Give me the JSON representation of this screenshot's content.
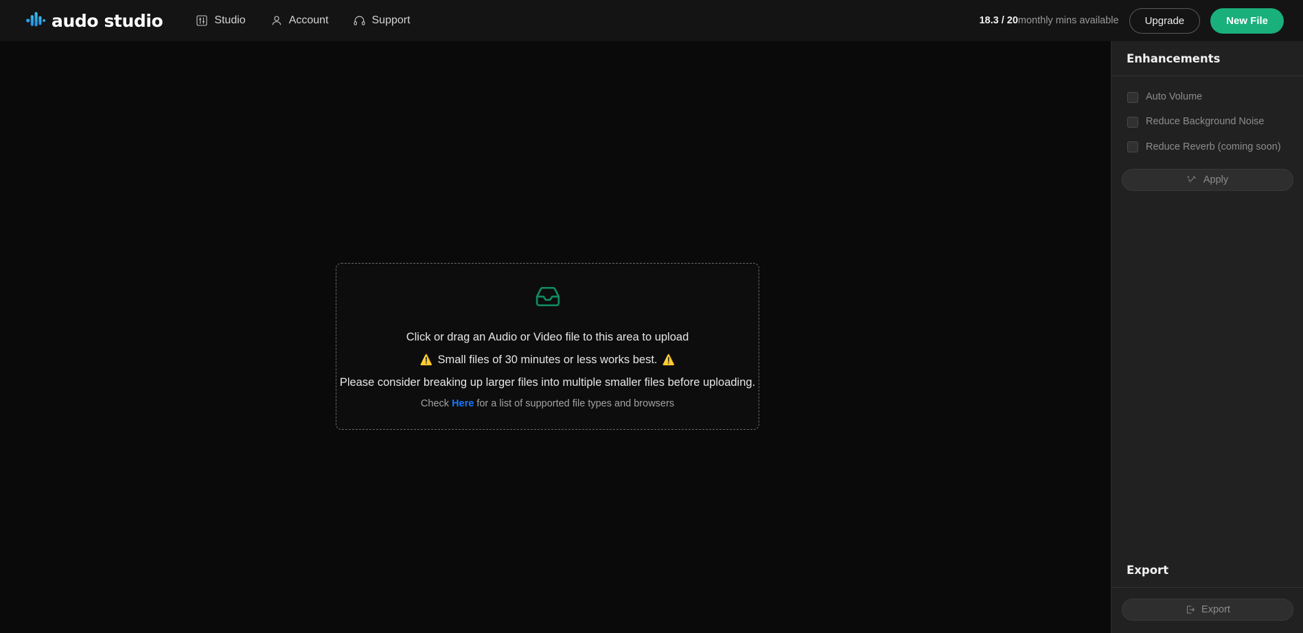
{
  "header": {
    "logo_text": "audo studio",
    "logo_icon": "waveform-icon",
    "nav": [
      {
        "label": "Studio",
        "icon": "sliders-icon"
      },
      {
        "label": "Account",
        "icon": "user-icon"
      },
      {
        "label": "Support",
        "icon": "headphones-icon"
      }
    ],
    "usage": {
      "amount": "18.3 / 20",
      "suffix": "monthly mins available"
    },
    "upgrade_label": "Upgrade",
    "new_file_label": "New File"
  },
  "dropzone": {
    "icon": "inbox-tray-icon",
    "line1": "Click or drag an Audio or Video file to this area to upload",
    "line2": "Small files of 30 minutes or less works best.",
    "warning_glyph": "⚠️",
    "line3": "Please consider breaking up larger files into multiple smaller files before uploading.",
    "line4_prefix": "Check ",
    "line4_link": "Here",
    "line4_suffix": " for a list of supported file types and browsers"
  },
  "panel": {
    "enhancements_title": "Enhancements",
    "checkboxes": [
      {
        "label": "Auto Volume",
        "checked": false,
        "disabled": true
      },
      {
        "label": "Reduce Background Noise",
        "checked": false,
        "disabled": true
      },
      {
        "label": "Reduce Reverb (coming soon)",
        "checked": false,
        "disabled": true
      }
    ],
    "apply_label": "Apply",
    "apply_icon": "magic-wand-icon",
    "export_title": "Export",
    "export_label": "Export",
    "export_icon": "export-arrow-icon"
  },
  "colors": {
    "accent_green": "#19b07c",
    "link_blue": "#1778ff",
    "icon_green": "#118a63",
    "panel_bg": "#212121",
    "canvas_bg": "#0a0a0a",
    "header_bg": "#141414"
  }
}
